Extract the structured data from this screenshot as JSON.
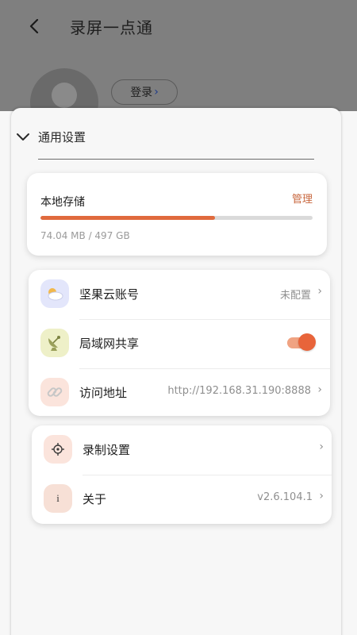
{
  "header": {
    "title": "录屏一点通",
    "login_label": "登录"
  },
  "section": {
    "title": "通用设置"
  },
  "storage": {
    "label": "本地存储",
    "manage_label": "管理",
    "usage_text": "74.04 MB / 497 GB",
    "usage_fraction": 0.64
  },
  "settings": [
    {
      "label": "坚果云账号",
      "value": "未配置",
      "icon": "cloud-sun-icon",
      "icon_bg": "#e3e6fb"
    },
    {
      "label": "局域网共享",
      "toggle": true,
      "icon": "satellite-dish-icon",
      "icon_bg": "#eef0c8"
    },
    {
      "label": "访问地址",
      "value": "http://192.168.31.190:8888",
      "icon": "link-icon",
      "icon_bg": "#fbe4dc"
    }
  ],
  "more": [
    {
      "label": "录制设置",
      "value": "",
      "icon": "gear-icon",
      "icon_bg": "#fbe4dc"
    },
    {
      "label": "关于",
      "value": "v2.6.104.1",
      "icon": "info-icon",
      "icon_bg": "#f7e0d6"
    }
  ],
  "colors": {
    "accent": "#e06a3d",
    "manage": "#c8673e",
    "toggle_on": "#e8643a"
  }
}
